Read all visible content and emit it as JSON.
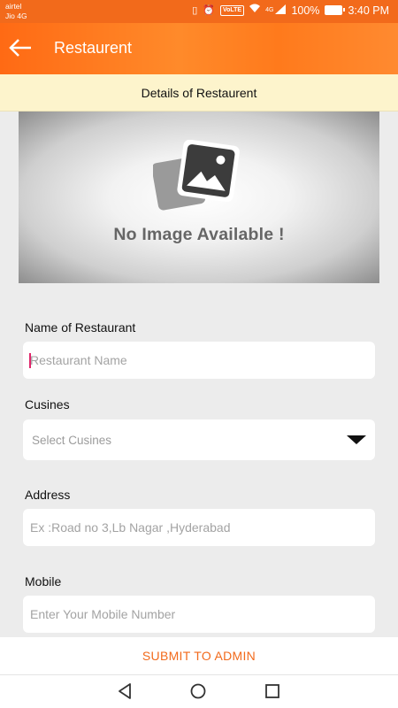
{
  "status_bar": {
    "carrier_1": "airtel",
    "carrier_2": "Jio 4G",
    "network_type": "4G",
    "volte": "VoLTE",
    "battery": "100%",
    "time": "3:40 PM"
  },
  "app_bar": {
    "title": "Restaurent"
  },
  "section": {
    "title": "Details of Restaurent"
  },
  "image_placeholder": {
    "text": "No Image Available !"
  },
  "form": {
    "name": {
      "label": "Name of Restaurant",
      "placeholder": "Restaurant Name",
      "value": ""
    },
    "cuisines": {
      "label": "Cusines",
      "selected": "Select Cusines"
    },
    "address": {
      "label": "Address",
      "placeholder": "Ex :Road no 3,Lb Nagar ,Hyderabad",
      "value": ""
    },
    "mobile": {
      "label": "Mobile",
      "placeholder": "Enter Your Mobile Number",
      "value": ""
    }
  },
  "actions": {
    "submit_label": "SUBMIT TO ADMIN"
  },
  "colors": {
    "accent": "#f26a1b",
    "banner": "#fdf4cc",
    "background": "#ececec"
  }
}
